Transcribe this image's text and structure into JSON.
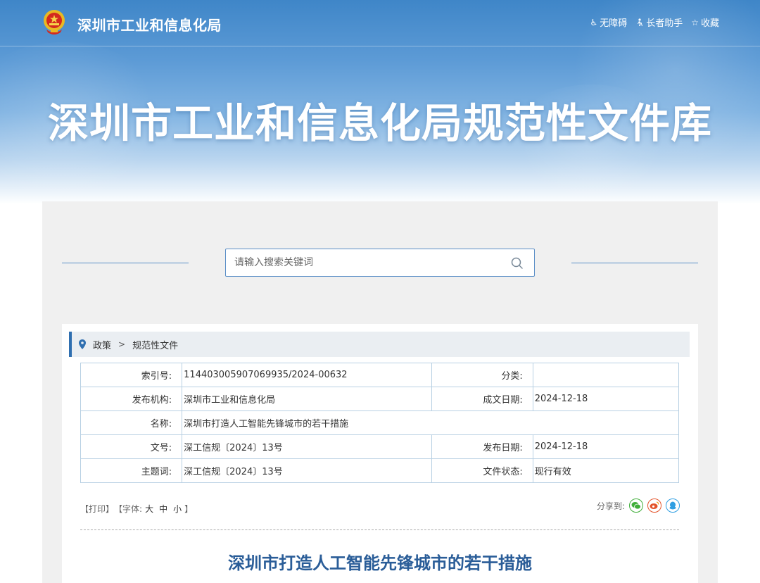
{
  "header": {
    "site_name": "深圳市工业和信息化局",
    "banner_title": "深圳市工业和信息化局规范性文件库",
    "links": [
      {
        "label": "无障碍",
        "icon": "accessibility-icon"
      },
      {
        "label": "长者助手",
        "icon": "elder-icon"
      },
      {
        "label": "收藏",
        "icon": "star-icon"
      }
    ]
  },
  "search": {
    "placeholder": "请输入搜索关键词"
  },
  "breadcrumb": {
    "items": [
      "政策",
      "规范性文件"
    ]
  },
  "meta": {
    "index_label": "索引号:",
    "index_value": "114403005907069935/2024-00632",
    "category_label": "分类:",
    "category_value": "",
    "publisher_label": "发布机构:",
    "publisher_value": "深圳市工业和信息化局",
    "created_label": "成文日期:",
    "created_value": "2024-12-18",
    "name_label": "名称:",
    "name_value": "深圳市打造人工智能先锋城市的若干措施",
    "docno_label": "文号:",
    "docno_value": "深工信规〔2024〕13号",
    "release_label": "发布日期:",
    "release_value": "2024-12-18",
    "keywords_label": "主题词:",
    "keywords_value": "深工信规〔2024〕13号",
    "status_label": "文件状态:",
    "status_value": "现行有效"
  },
  "tools": {
    "print": "【打印】",
    "font_prefix": "【字体:",
    "font_large": "大",
    "font_medium": "中",
    "font_small": "小",
    "font_suffix": "】",
    "share_label": "分享到:"
  },
  "document": {
    "title": "深圳市打造人工智能先锋城市的若干措施"
  },
  "colors": {
    "accent": "#2f6fb0",
    "title_blue": "#2a5d98",
    "wechat": "#3fae39",
    "weibo": "#e3532a",
    "qq": "#2f9ee2"
  }
}
